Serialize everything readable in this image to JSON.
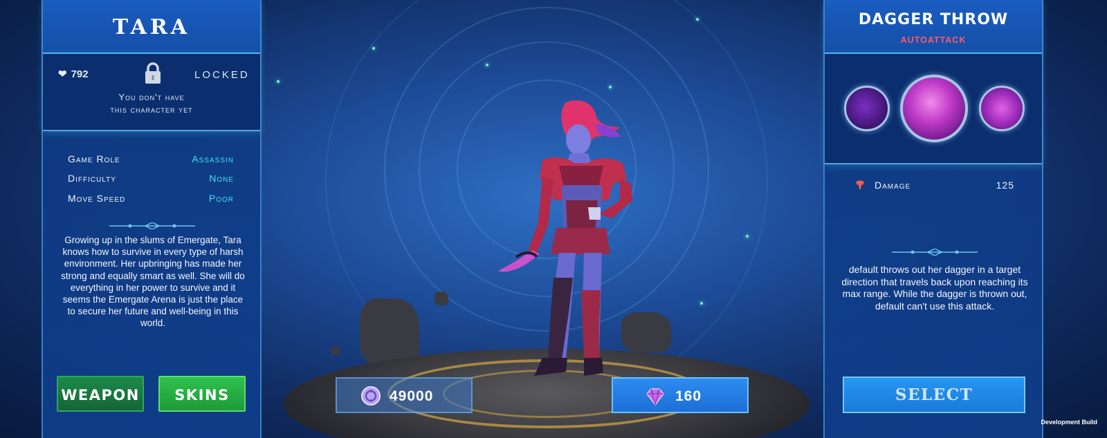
{
  "character": {
    "name": "TARA",
    "health": "792",
    "status": "LOCKED",
    "locked_message_line1": "You don't have",
    "locked_message_line2": "this character yet",
    "stats": [
      {
        "label": "Game Role",
        "value": "Assassin"
      },
      {
        "label": "Difficulty",
        "value": "None"
      },
      {
        "label": "Move Speed",
        "value": "Poor"
      }
    ],
    "bio": "Growing up in the slums of Emergate, Tara knows how to survive in every type of harsh environment. Her upbringing has made her strong and equally smart as well. She will do everything in her power to survive and it seems the Emergate Arena is just the place to secure her future and well-being in this world."
  },
  "buttons": {
    "weapon": "WEAPON",
    "skins": "SKINS",
    "select": "SELECT"
  },
  "currency": {
    "coins": "49000",
    "gems": "160"
  },
  "ability": {
    "name": "DAGGER THROW",
    "type": "AUTOATTACK",
    "stat_label": "Damage",
    "stat_value": "125",
    "description": "default throws out her dagger in a target direction that travels back upon reaching its max range. While the dagger is thrown out, default can't use this attack.",
    "icons": [
      "shadow-figure-icon",
      "dagger-slash-icon",
      "vortex-icon"
    ]
  },
  "footer": {
    "build_label": "Development Build"
  },
  "colors": {
    "stat_value": "#3ee3f0",
    "ability_type": "#ff5a6a",
    "weapon_button": "#1d8a4a",
    "skins_button": "#2fc14e",
    "select_button": "#2796f2"
  }
}
